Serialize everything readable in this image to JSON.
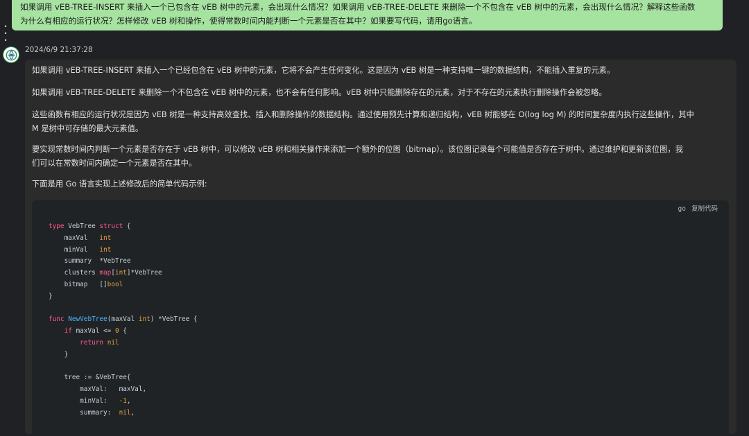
{
  "user_message": {
    "line1": "如果调用 vEB-TREE-INSERT 来插入一个已包含在 vEB 树中的元素，会出现什么情况？如果调用 vEB-TREE-DELETE 来删除一个不包含在 vEB 树中的元素，会出现什么情况？解释这些函数",
    "line2": "为什么有相应的运行状况？怎样修改 vEB 树和操作，使得常数时间内能判断一个元素是否在其中？如果要写代码，请用go语言。"
  },
  "assistant": {
    "timestamp": "2024/6/9 21:37:28",
    "avatar_icon": "assistant-logo-icon",
    "paragraphs": [
      [
        "如果调用 vEB-TREE-INSERT 来插入一个已经包含在 vEB 树中的元素，它将不会产生任何变化。这是因为 vEB 树是一种支持唯一键的数据结构，不能插入重复的元素。"
      ],
      [
        "如果调用 vEB-TREE-DELETE 来删除一个不包含在 vEB 树中的元素，也不会有任何影响。vEB 树中只能删除存在的元素，对于不存在的元素执行删除操作会被忽略。"
      ],
      [
        "这些函数有相应的运行状况是因为 vEB 树是一种支持高效查找、插入和删除操作的数据结构。通过使用预先计算和递归结构，vEB 树能够在 O(log log M) 的时间复杂度内执行这些操作，其中",
        "M 是树中可存储的最大元素值。"
      ],
      [
        "要实现常数时间内判断一个元素是否存在于 vEB 树中，可以修改 vEB 树和相关操作来添加一个额外的位图（bitmap）。该位图记录每个可能值是否存在于树中。通过维护和更新该位图，我",
        "们可以在常数时间内确定一个元素是否在其中。"
      ],
      [
        "下面是用 Go 语言实现上述修改后的简单代码示例:"
      ]
    ],
    "code": {
      "language": "go",
      "copy_label": "复制代码",
      "lines": [
        [
          [
            "kw",
            "type"
          ],
          [
            "p",
            " VebTree "
          ],
          [
            "kw",
            "struct"
          ],
          [
            "p",
            " {"
          ]
        ],
        [
          [
            "p",
            "    maxVal   "
          ],
          [
            "ty",
            "int"
          ]
        ],
        [
          [
            "p",
            "    minVal   "
          ],
          [
            "ty",
            "int"
          ]
        ],
        [
          [
            "p",
            "    summary  *VebTree"
          ]
        ],
        [
          [
            "p",
            "    clusters "
          ],
          [
            "kw",
            "map"
          ],
          [
            "p",
            "["
          ],
          [
            "ty",
            "int"
          ],
          [
            "p",
            "]*VebTree"
          ]
        ],
        [
          [
            "p",
            "    bitmap   []"
          ],
          [
            "ty",
            "bool"
          ]
        ],
        [
          [
            "p",
            "}"
          ]
        ],
        [],
        [
          [
            "kw",
            "func"
          ],
          [
            "p",
            " "
          ],
          [
            "fn",
            "NewVebTree"
          ],
          [
            "p",
            "(maxVal "
          ],
          [
            "ty",
            "int"
          ],
          [
            "p",
            ") *VebTree {"
          ]
        ],
        [
          [
            "p",
            "    "
          ],
          [
            "kw",
            "if"
          ],
          [
            "p",
            " maxVal <= "
          ],
          [
            "num",
            "0"
          ],
          [
            "p",
            " {"
          ]
        ],
        [
          [
            "p",
            "        "
          ],
          [
            "kw",
            "return"
          ],
          [
            "p",
            " "
          ],
          [
            "ty",
            "nil"
          ]
        ],
        [
          [
            "p",
            "    }"
          ]
        ],
        [],
        [
          [
            "p",
            "    tree := &VebTree{"
          ]
        ],
        [
          [
            "p",
            "        maxVal:   maxVal,"
          ]
        ],
        [
          [
            "p",
            "        minVal:   "
          ],
          [
            "num",
            "-1"
          ],
          [
            "p",
            ","
          ]
        ],
        [
          [
            "p",
            "        summary:  "
          ],
          [
            "ty",
            "nil"
          ],
          [
            "p",
            ","
          ]
        ]
      ]
    }
  }
}
